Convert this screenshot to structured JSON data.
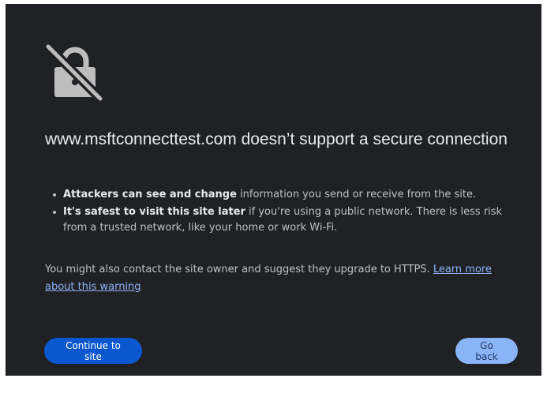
{
  "headline": "www.msftconnecttest.com doesn’t support a secure connection",
  "bullets": [
    {
      "bold": "Attackers can see and change",
      "text": " information you send or receive from the site."
    },
    {
      "bold": "It's safest to visit this site later",
      "text": " if you're using a public network. There is less risk from a trusted network, like your home or work Wi-Fi."
    }
  ],
  "note": {
    "text": "You might also contact the site owner and suggest they upgrade to HTTPS. ",
    "link": "Learn more about this warning"
  },
  "buttons": {
    "continue": "Continue to site",
    "back": "Go back"
  },
  "icons": {
    "main": "lock-slash-icon"
  },
  "colors": {
    "background": "#202124",
    "primary_button": "#0b57d0",
    "secondary_button": "#8ab4f8",
    "link": "#8ab4f8"
  }
}
